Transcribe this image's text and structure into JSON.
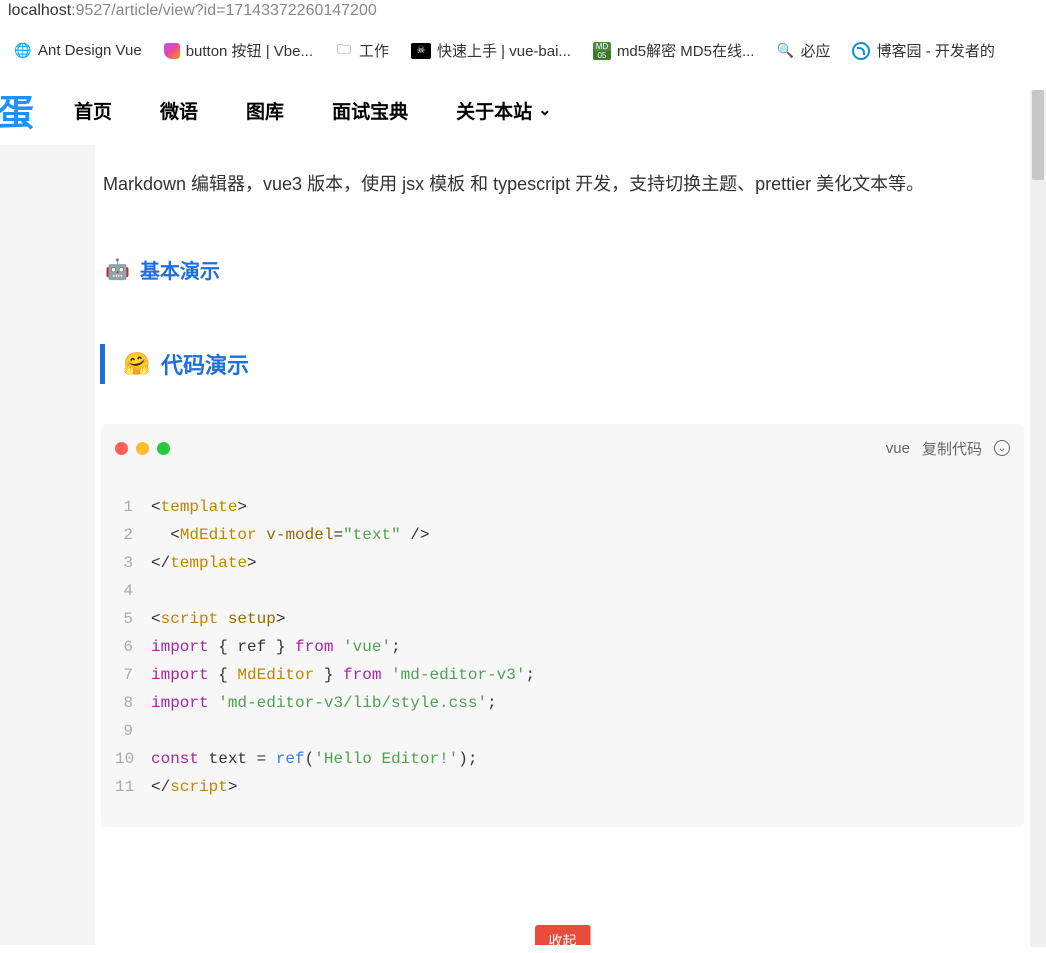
{
  "url": {
    "host": "localhost",
    "port": ":9527",
    "path": "/article/view?id=17143372260147200"
  },
  "bookmarks": [
    {
      "icon": "globe",
      "label": "Ant Design Vue"
    },
    {
      "icon": "button",
      "label": "button 按钮 | Vbe..."
    },
    {
      "icon": "folder",
      "label": "工作"
    },
    {
      "icon": "pirate",
      "label": "快速上手 | vue-bai..."
    },
    {
      "icon": "md5",
      "label": "md5解密 MD5在线..."
    },
    {
      "icon": "search",
      "label": "必应"
    },
    {
      "icon": "cnblogs",
      "label": "博客园 - 开发者的"
    }
  ],
  "logo": "蛋",
  "nav": [
    {
      "label": "首页",
      "dropdown": false
    },
    {
      "label": "微语",
      "dropdown": false
    },
    {
      "label": "图库",
      "dropdown": false
    },
    {
      "label": "面试宝典",
      "dropdown": false
    },
    {
      "label": "关于本站",
      "dropdown": true
    }
  ],
  "article": {
    "intro": "Markdown 编辑器，vue3 版本，使用 jsx 模板 和 typescript 开发，支持切换主题、prettier 美化文本等。",
    "section_basic": "基本演示",
    "section_basic_emoji": "🤖",
    "section_code": "代码演示",
    "section_code_emoji": "🤗",
    "code_lang": "vue",
    "copy_label": "复制代码",
    "footer_btn": "收起"
  },
  "code": {
    "lines": [
      {
        "n": 1,
        "segments": [
          {
            "t": "<",
            "c": "punct"
          },
          {
            "t": "template",
            "c": "tag"
          },
          {
            "t": ">",
            "c": "punct"
          }
        ]
      },
      {
        "n": 2,
        "segments": [
          {
            "t": "  <",
            "c": "punct"
          },
          {
            "t": "MdEditor",
            "c": "class"
          },
          {
            "t": " ",
            "c": "punct"
          },
          {
            "t": "v-model",
            "c": "attr"
          },
          {
            "t": "=",
            "c": "punct"
          },
          {
            "t": "\"text\"",
            "c": "string"
          },
          {
            "t": " />",
            "c": "punct"
          }
        ]
      },
      {
        "n": 3,
        "segments": [
          {
            "t": "</",
            "c": "punct"
          },
          {
            "t": "template",
            "c": "tag"
          },
          {
            "t": ">",
            "c": "punct"
          }
        ]
      },
      {
        "n": 4,
        "segments": []
      },
      {
        "n": 5,
        "segments": [
          {
            "t": "<",
            "c": "punct"
          },
          {
            "t": "script",
            "c": "tag"
          },
          {
            "t": " ",
            "c": "punct"
          },
          {
            "t": "setup",
            "c": "attr"
          },
          {
            "t": ">",
            "c": "punct"
          }
        ]
      },
      {
        "n": 6,
        "segments": [
          {
            "t": "import",
            "c": "keyword"
          },
          {
            "t": " { ref } ",
            "c": "ident"
          },
          {
            "t": "from",
            "c": "from"
          },
          {
            "t": " ",
            "c": "ident"
          },
          {
            "t": "'vue'",
            "c": "module"
          },
          {
            "t": ";",
            "c": "punct"
          }
        ]
      },
      {
        "n": 7,
        "segments": [
          {
            "t": "import",
            "c": "keyword"
          },
          {
            "t": " { ",
            "c": "ident"
          },
          {
            "t": "MdEditor",
            "c": "class"
          },
          {
            "t": " } ",
            "c": "ident"
          },
          {
            "t": "from",
            "c": "from"
          },
          {
            "t": " ",
            "c": "ident"
          },
          {
            "t": "'md-editor-v3'",
            "c": "module"
          },
          {
            "t": ";",
            "c": "punct"
          }
        ]
      },
      {
        "n": 8,
        "segments": [
          {
            "t": "import",
            "c": "keyword"
          },
          {
            "t": " ",
            "c": "ident"
          },
          {
            "t": "'md-editor-v3/lib/style.css'",
            "c": "module"
          },
          {
            "t": ";",
            "c": "punct"
          }
        ]
      },
      {
        "n": 9,
        "segments": []
      },
      {
        "n": 10,
        "segments": [
          {
            "t": "const",
            "c": "keyword"
          },
          {
            "t": " text = ",
            "c": "ident"
          },
          {
            "t": "ref",
            "c": "func"
          },
          {
            "t": "(",
            "c": "punct"
          },
          {
            "t": "'Hello Editor!'",
            "c": "module"
          },
          {
            "t": ");",
            "c": "punct"
          }
        ]
      },
      {
        "n": 11,
        "segments": [
          {
            "t": "</",
            "c": "punct"
          },
          {
            "t": "script",
            "c": "tag"
          },
          {
            "t": ">",
            "c": "punct"
          }
        ]
      }
    ]
  }
}
